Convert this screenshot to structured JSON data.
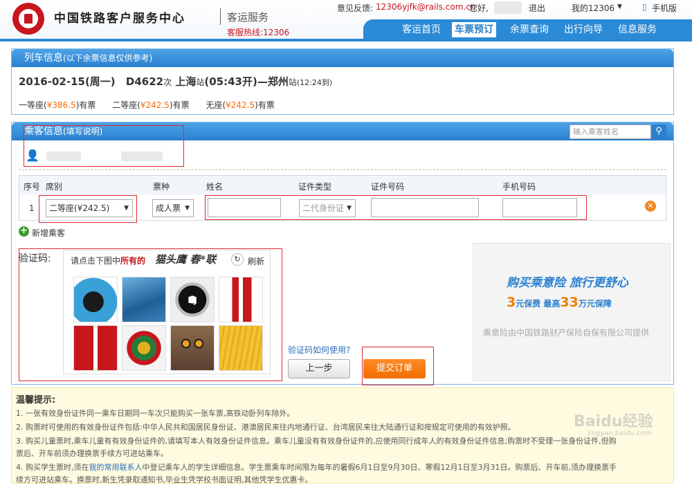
{
  "header": {
    "site_title": "中国铁路客户服务中心",
    "sub_title": "客运服务",
    "hotline": "客服热线:12306",
    "feedback_label": "意见反馈:",
    "feedback_email": "12306yjfk@rails.com.cn",
    "greeting": "您好,",
    "logout": "退出",
    "my12306": "我的12306",
    "mobile": "手机版",
    "nav": [
      "客运首页",
      "车票预订",
      "余票查询",
      "出行向导",
      "信息服务"
    ],
    "nav_active": 1
  },
  "train": {
    "section_title": "列车信息",
    "section_note": "(以下余票信息仅供参考)",
    "date": "2016-02-15(周一)",
    "train_no": "D4622",
    "train_suffix": "次",
    "from": "上海",
    "station_suffix1": "站",
    "depart": "(05:43开)—",
    "to": "郑州",
    "station_suffix2": "站",
    "arrive": "(12:24到)",
    "seats": [
      {
        "name": "一等座(",
        "price": "¥386.5",
        "close": ")",
        "status": "有票"
      },
      {
        "name": "二等座(",
        "price": "¥242.5",
        "close": ")",
        "status": "有票"
      },
      {
        "name": "无座(",
        "price": "¥242.5",
        "close": ")",
        "status": "有票"
      }
    ]
  },
  "passenger": {
    "section_title": "乘客信息",
    "section_note": "(填写说明)",
    "search_placeholder": "输入乘客姓名",
    "columns": [
      "序号",
      "席别",
      "票种",
      "姓名",
      "证件类型",
      "证件号码",
      "手机号码"
    ],
    "row": {
      "index": "1",
      "seat": "二等座(¥242.5)",
      "ticket_type": "成人票",
      "id_type": "二代身份证"
    },
    "add_label": "新增乘客"
  },
  "captcha": {
    "label": "验证码:",
    "instruction_pre": "请点击下图中",
    "instruction_em": "所有的",
    "target_words": "猫头鹰 春*联",
    "refresh": "刷新",
    "help_link": "验证码如何使用?",
    "prev_button": "上一步",
    "submit_button": "提交订单"
  },
  "insurance": {
    "headline": "购买乘意险 旅行更舒心",
    "line2_a": "3",
    "line2_b": "元保费 最高",
    "line2_c": "33",
    "line2_d": "万元保障",
    "provider": "乘意险由中国铁路财产保险自保有限公司提供"
  },
  "tips": {
    "title": "温馨提示:",
    "items": [
      "1. 一张有效身份证件同一乘车日期同一车次只能购买一张车票,高铁动卧列车除外。",
      "2. 购票时可使用的有效身份证件包括:中华人民共和国居民身份证、港澳居民来往内地通行证、台湾居民来往大陆通行证和按规定可使用的有效护照。",
      "3. 购买儿童票时,乘车儿童有有效身份证件的,请填写本人有效身份证件信息。乘车儿童没有有效身份证件的,应使用同行成年人的有效身份证件信息;购票时不受理一张身份证件,但购",
      "票后、开车前须办理换票手续方可进站乘车。",
      "4. 购买学生票时,须在",
      "我的常用联系人",
      "中登记乘车人的学生详细信息。学生票乘车时间限为每年的暑假6月1日至9月30日、寒假12月1日至3月31日。购票后、开车前,须办理换票手",
      "续方可进站乘车。换票时,新生凭录取通知书,毕业生凭学校书面证明,其他凭学生优惠卡。"
    ]
  },
  "watermark": "Baidu经验",
  "watermark_sub": "jingyan.baidu.com"
}
